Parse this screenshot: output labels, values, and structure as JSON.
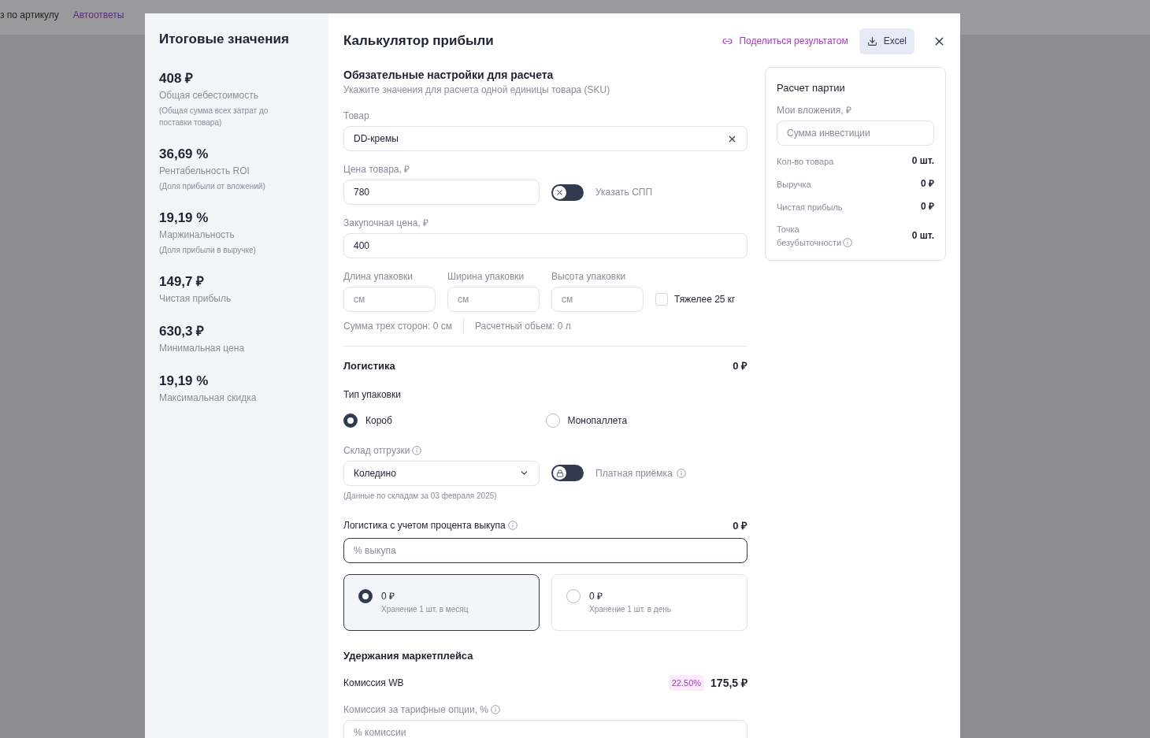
{
  "background_nav": [
    {
      "label": "з по артикулу",
      "selected": false
    },
    {
      "label": "Автоответы",
      "selected": true
    }
  ],
  "summary": {
    "title": "Итоговые значения",
    "items": [
      {
        "value": "408 ₽",
        "label": "Общая себестоимость",
        "note": "(Общая сумма всех затрат до поставки товара)"
      },
      {
        "value": "36,69 %",
        "label": "Рентабельность ROI",
        "note": "(Доля прибыли от вложений)"
      },
      {
        "value": "19,19 %",
        "label": "Маржинальность",
        "note": "(Доля прибыли в выручке)"
      },
      {
        "value": "149,7 ₽",
        "label": "Чистая прибыль"
      },
      {
        "value": "630,3 ₽",
        "label": "Минимальная цена"
      },
      {
        "value": "19,19 %",
        "label": "Максимальная скидка"
      }
    ]
  },
  "calculator": {
    "title": "Калькулятор прибыли",
    "share_link": "Поделиться результатом",
    "excel_button": "Excel"
  },
  "required": {
    "title": "Обязательные настройки для расчета",
    "subtitle": "Укажите значения для расчета одной единицы товара (SKU)",
    "product": {
      "label": "Товар",
      "value": "DD-кремы"
    },
    "price": {
      "label": "Цена товара, ₽",
      "value": "780"
    },
    "spp_toggle": {
      "label": "Указать СПП",
      "on": false
    },
    "purchase": {
      "label": "Закупочная цена, ₽",
      "value": "400"
    },
    "dims": [
      {
        "label": "Длина упаковки",
        "placeholder": "см"
      },
      {
        "label": "Ширина упаковки",
        "placeholder": "см"
      },
      {
        "label": "Высота упаковки",
        "placeholder": "см"
      }
    ],
    "heavy": {
      "label": "Тяжелее 25 кг",
      "checked": false
    },
    "sum_sides": "Сумма трех сторон: 0 см",
    "volume": "Расчетный обьем: 0 л"
  },
  "logistics": {
    "title": "Логистика",
    "amount": "0 ₽",
    "pack_type_label": "Тип упаковки",
    "pack_types": [
      {
        "label": "Короб",
        "selected": true
      },
      {
        "label": "Монопаллета",
        "selected": false
      }
    ],
    "warehouse": {
      "label": "Склад отгрузки",
      "value": "Коледино"
    },
    "paid_acceptance": {
      "label": "Платная приёмка",
      "on": false
    },
    "data_note": "(Данные по складам за 03 февраля 2025)",
    "buyout": {
      "label": "Логистика с учетом процента выкупа",
      "amount": "0 ₽",
      "placeholder": "% выкупа"
    },
    "storage_options": [
      {
        "amount": "0 ₽",
        "label": "Хранение 1 шт. в месяц",
        "selected": true
      },
      {
        "amount": "0 ₽",
        "label": "Хранение 1 шт. в день",
        "selected": false
      }
    ]
  },
  "marketplace": {
    "title": "Удержания маркетплейса",
    "commission": {
      "label": "Комиссия WB",
      "badge": "22.50%",
      "amount": "175,5 ₽"
    },
    "tariff": {
      "label": "Комиссия за тарифные опции, %",
      "placeholder": "% комиссии"
    }
  },
  "batch": {
    "title": "Расчет партии",
    "investment": {
      "label": "Мои вложения, ₽",
      "placeholder": "Сумма инвестиции"
    },
    "rows": [
      {
        "label": "Кол-во товара",
        "value": "0 шт.",
        "info": false
      },
      {
        "label": "Выручка",
        "value": "0 ₽",
        "info": false
      },
      {
        "label": "Чистая прибыль",
        "value": "0 ₽",
        "info": false
      },
      {
        "label": "Точка безубыточности",
        "value": "0 шт.",
        "info": true
      }
    ]
  }
}
